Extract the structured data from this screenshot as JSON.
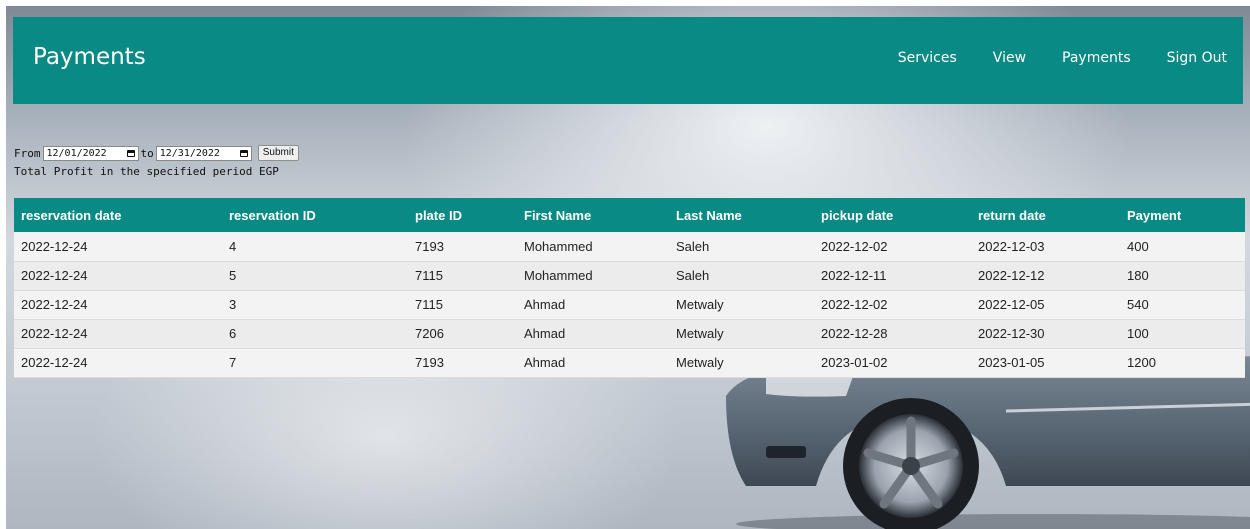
{
  "header": {
    "title": "Payments",
    "nav": [
      {
        "label": "Services"
      },
      {
        "label": "View"
      },
      {
        "label": "Payments"
      },
      {
        "label": "Sign Out"
      }
    ]
  },
  "filter": {
    "from_label": "From",
    "from_value": "12/01/2022",
    "to_label": "to",
    "to_value": "12/31/2022",
    "submit_label": "Submit",
    "profit_text": "Total Profit in the specified period EGP"
  },
  "table": {
    "columns": [
      "reservation date",
      "reservation ID",
      "plate ID",
      "First Name",
      "Last Name",
      "pickup date",
      "return date",
      "Payment"
    ],
    "rows": [
      [
        "2022-12-24",
        "4",
        "7193",
        "Mohammed",
        "Saleh",
        "2022-12-02",
        "2022-12-03",
        "400"
      ],
      [
        "2022-12-24",
        "5",
        "7115",
        "Mohammed",
        "Saleh",
        "2022-12-11",
        "2022-12-12",
        "180"
      ],
      [
        "2022-12-24",
        "3",
        "7115",
        "Ahmad",
        "Metwaly",
        "2022-12-02",
        "2022-12-05",
        "540"
      ],
      [
        "2022-12-24",
        "6",
        "7206",
        "Ahmad",
        "Metwaly",
        "2022-12-28",
        "2022-12-30",
        "100"
      ],
      [
        "2022-12-24",
        "7",
        "7193",
        "Ahmad",
        "Metwaly",
        "2023-01-02",
        "2023-01-05",
        "1200"
      ]
    ]
  },
  "theme": {
    "accent": "#0a8a84"
  }
}
